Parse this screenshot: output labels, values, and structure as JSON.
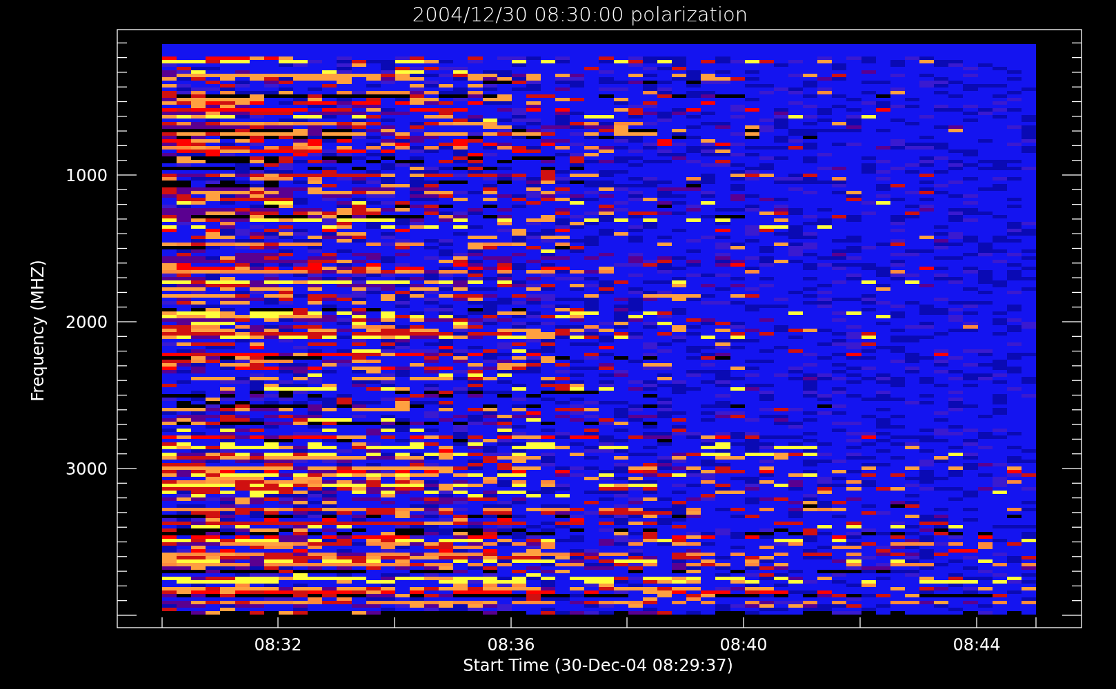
{
  "title": "2004/12/30 08:30:00 polarization",
  "y_axis": {
    "label": "Frequency (MHZ)",
    "ticks": [
      "1000",
      "2000",
      "3000"
    ]
  },
  "x_axis": {
    "label": "Start Time (30-Dec-04 08:29:37)",
    "ticks": [
      "08:32",
      "08:36",
      "08:40",
      "08:44"
    ]
  }
}
